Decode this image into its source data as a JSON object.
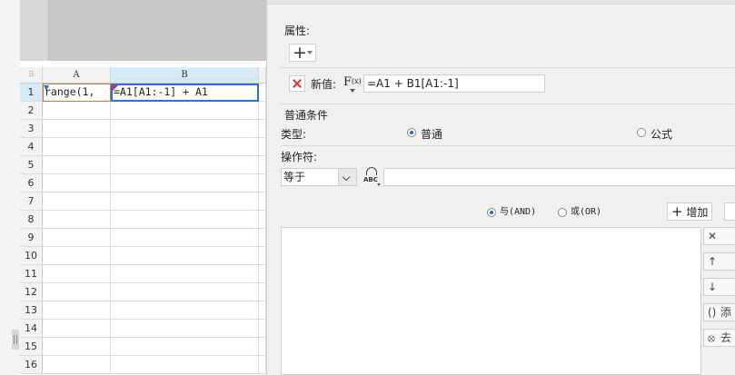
{
  "sheet": {
    "columns": [
      "A",
      "B"
    ],
    "rows": [
      "1",
      "2",
      "3",
      "4",
      "5",
      "6",
      "7",
      "8",
      "9",
      "10",
      "11",
      "12",
      "13",
      "14",
      "15",
      "16"
    ],
    "cells": {
      "A1": "range(1,",
      "B1": "=A1[A1:-1] + A1"
    }
  },
  "panel": {
    "properties_label": "属性:",
    "new_value_label": "新值:",
    "new_value_formula": "=A1 + B1[A1:-1]",
    "normal_condition_header": "普通条件",
    "type_label": "类型:",
    "type_option_normal": "普通",
    "type_option_formula": "公式",
    "operator_label": "操作符:",
    "operator_value": "等于",
    "abc_icon_text": "ABC",
    "logic_and": "与(AND)",
    "logic_or": "或(OR)",
    "add_button": "增加",
    "side_buttons": {
      "add_label": "添",
      "remove_label": "去"
    }
  },
  "icons": {
    "delete": "delete-x-icon",
    "formula": "fx-icon",
    "plus": "plus-icon",
    "up": "arrow-up-icon",
    "down": "arrow-down-icon"
  },
  "colors": {
    "selected_header": "#d6eaf8",
    "selection_border": "#2e6fcc",
    "radio_accent": "#1e6fd4",
    "delete_red": "#d33333"
  }
}
